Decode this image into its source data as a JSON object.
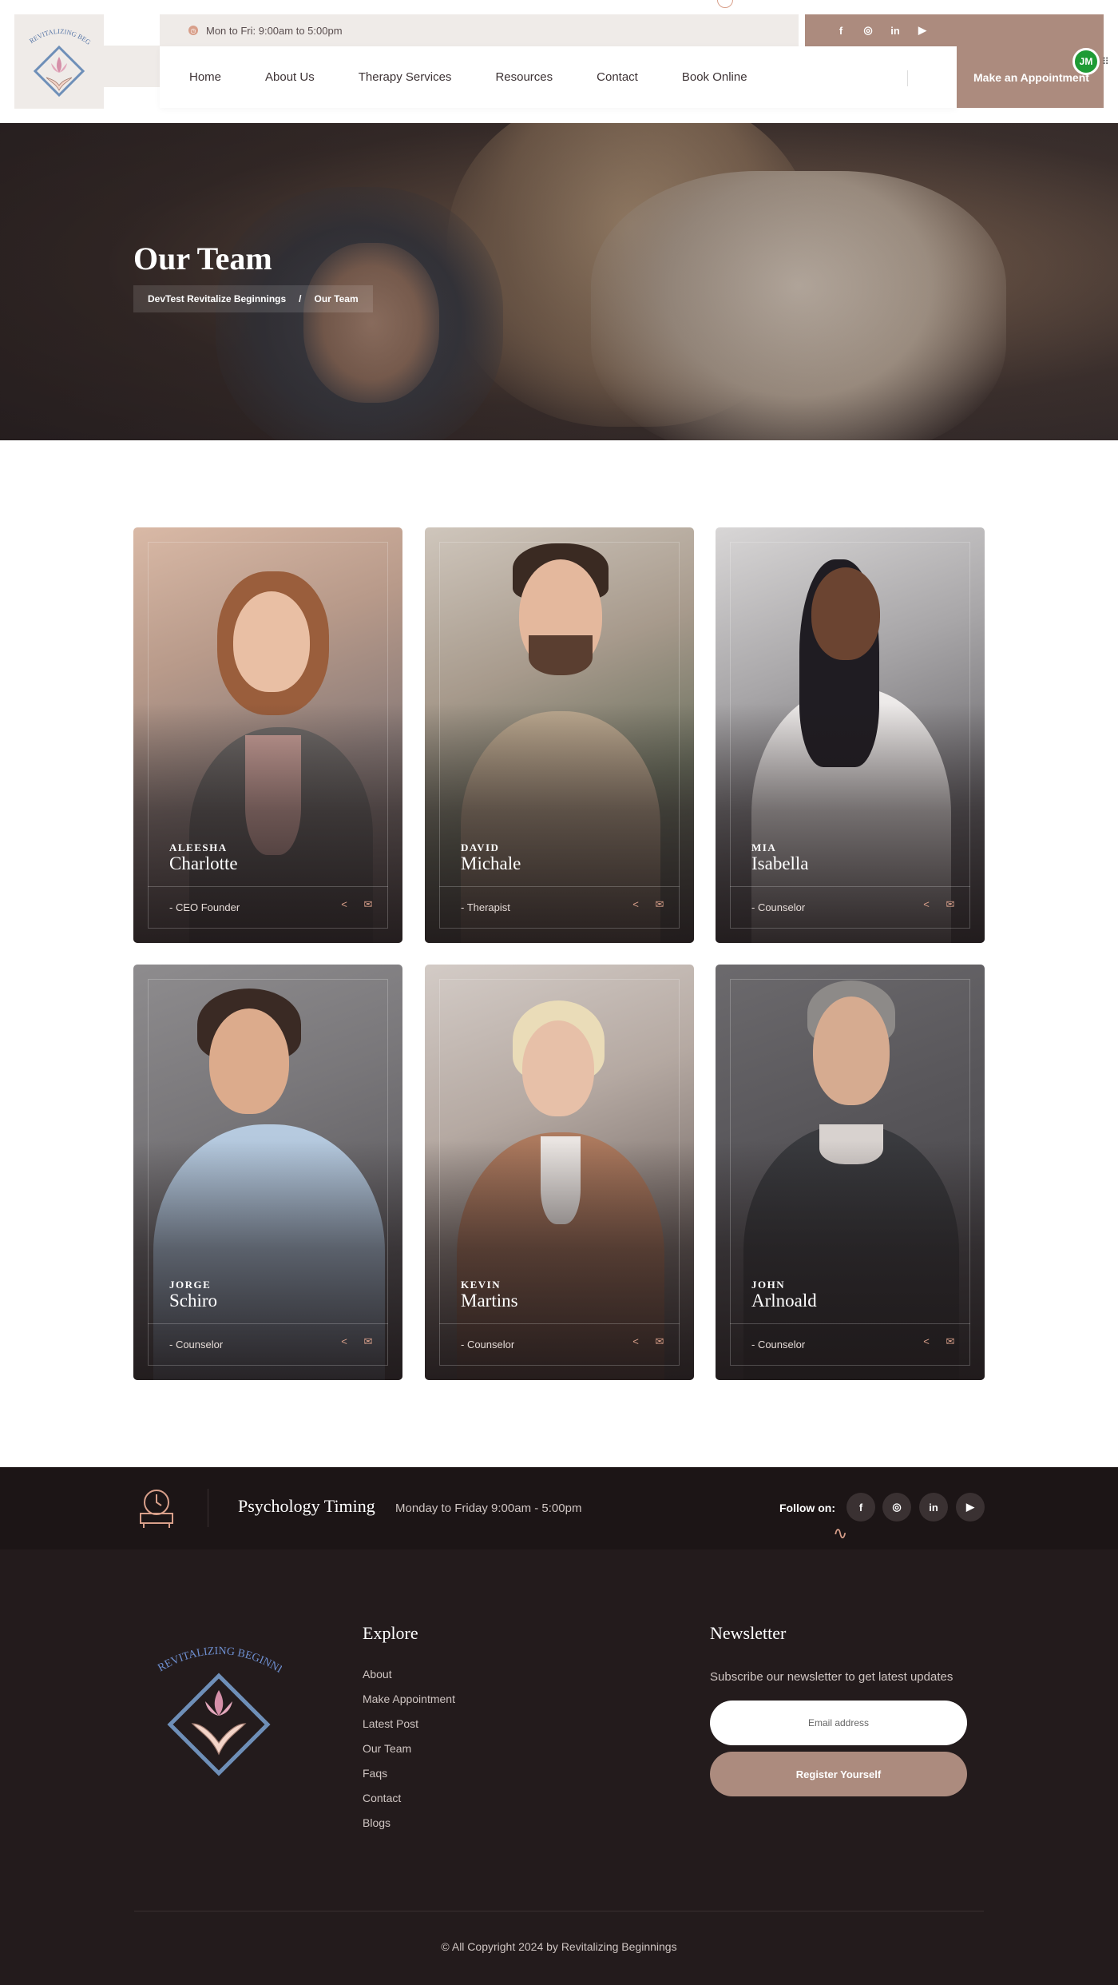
{
  "header": {
    "hours": "Mon to Fri: 9:00am to 5:00pm",
    "social": [
      {
        "icon": "facebook-icon",
        "glyph": "f"
      },
      {
        "icon": "instagram-icon",
        "glyph": "◎"
      },
      {
        "icon": "linkedin-icon",
        "glyph": "in"
      },
      {
        "icon": "youtube-icon",
        "glyph": "▶"
      }
    ],
    "nav": [
      "Home",
      "About Us",
      "Therapy Services",
      "Resources",
      "Contact",
      "Book Online"
    ],
    "cta_label": "Make an Appointment",
    "avatar_initials": "JM",
    "logo_text": "REVITALIZING BEGINNINGS"
  },
  "hero": {
    "title": "Our Team",
    "breadcrumb": [
      "DevTest Revitalize Beginnings",
      "/",
      "Our Team"
    ]
  },
  "team": [
    {
      "first": "ALEESHA",
      "last": "Charlotte",
      "role": "- CEO Founder"
    },
    {
      "first": "DAVID",
      "last": "Michale",
      "role": "- Therapist"
    },
    {
      "first": "MIA",
      "last": "Isabella",
      "role": "- Counselor"
    },
    {
      "first": "JORGE",
      "last": "Schiro",
      "role": "- Counselor"
    },
    {
      "first": "KEVIN",
      "last": "Martins",
      "role": "- Counselor"
    },
    {
      "first": "JOHN",
      "last": "Arlnoald",
      "role": "- Counselor"
    }
  ],
  "footer": {
    "timing_title": "Psychology Timing",
    "timing_hours": "Monday to Friday 9:00am - 5:00pm",
    "follow_label": "Follow on:",
    "explore_title": "Explore",
    "explore_links": [
      "About",
      "Make Appointment",
      "Latest Post",
      "Our Team",
      "Faqs",
      "Contact",
      "Blogs"
    ],
    "newsletter_title": "Newsletter",
    "newsletter_text": "Subscribe our newsletter to get latest updates",
    "email_placeholder": "Email address",
    "register_label": "Register Yourself",
    "copyright": "© All Copyright 2024 by Revitalizing Beginnings"
  },
  "colors": {
    "accent": "#ac8b7e",
    "accent_light": "#d89f8a",
    "footer_bg": "#231b1c",
    "footer_top_bg": "#1c1516"
  }
}
